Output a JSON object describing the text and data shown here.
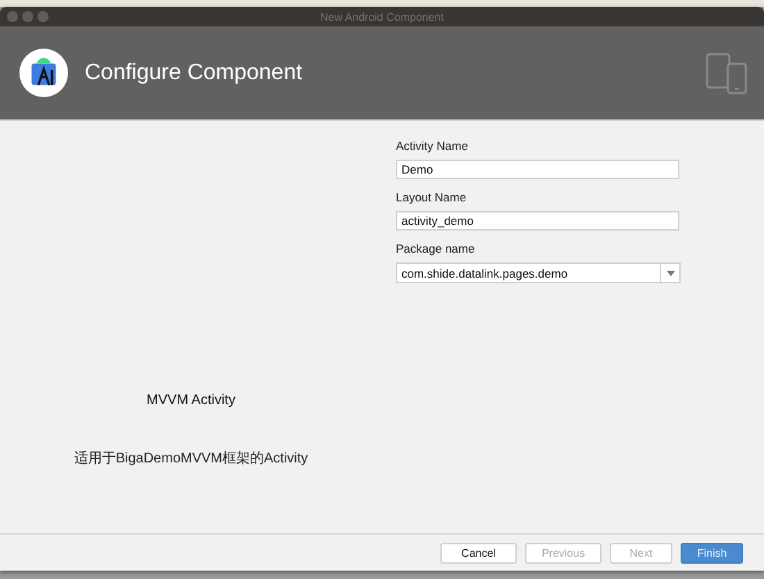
{
  "window": {
    "title": "New Android Component"
  },
  "header": {
    "title": "Configure Component"
  },
  "preview": {
    "name": "MVVM Activity",
    "description": "适用于BigaDemoMVVM框架的Activity"
  },
  "fields": [
    {
      "kind": "text",
      "label": "Activity Name",
      "value": "Demo"
    },
    {
      "kind": "text",
      "label": "Layout Name",
      "value": "activity_demo"
    },
    {
      "kind": "dropdown",
      "label": "Package name",
      "value": "com.shide.datalink.pages.demo"
    }
  ],
  "buttons": [
    {
      "label": "Cancel",
      "disabled": false,
      "primary": false
    },
    {
      "label": "Previous",
      "disabled": true,
      "primary": false
    },
    {
      "label": "Next",
      "disabled": true,
      "primary": false
    },
    {
      "label": "Finish",
      "disabled": false,
      "primary": true
    }
  ]
}
